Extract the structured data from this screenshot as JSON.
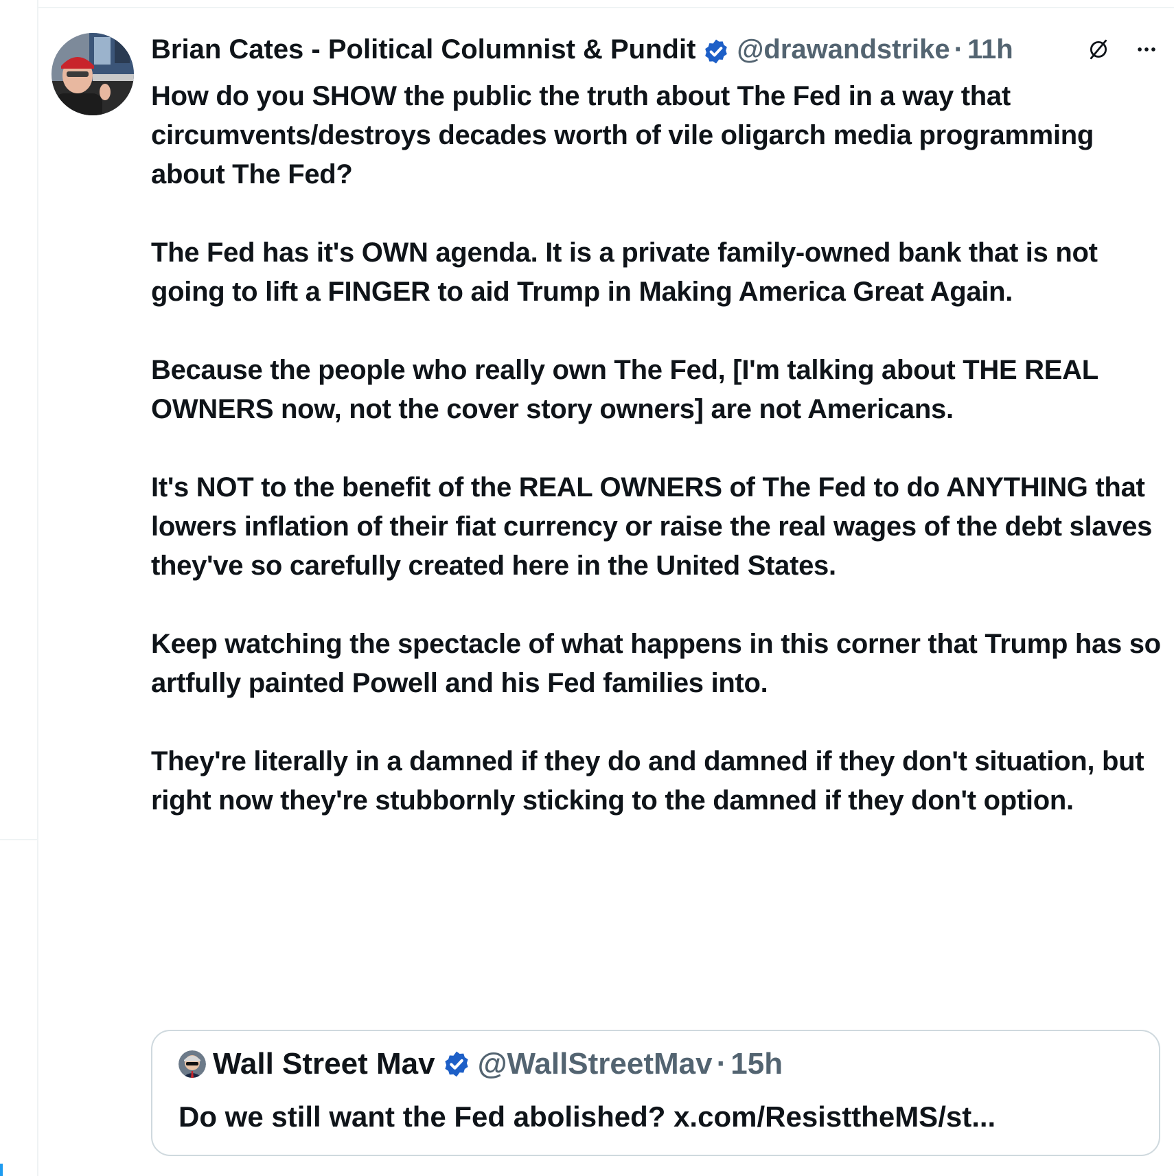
{
  "tweet": {
    "author": {
      "display_name": "Brian Cates - Political Columnist & Pundit",
      "handle": "@drawandstrike",
      "separator": "·",
      "time": "11h",
      "verified": true
    },
    "paragraphs": [
      "How do you SHOW the public the truth about The Fed in  a way that circumvents/destroys decades worth of vile oligarch media programming about The Fed?",
      "The Fed has it's OWN agenda. It is a private family-owned bank that is not going to lift a FINGER to aid Trump in Making America Great Again.",
      "Because the people who really own The Fed, [I'm talking about THE REAL OWNERS now, not the cover story owners] are not Americans.",
      "It's NOT to the benefit of the REAL OWNERS of The Fed to do ANYTHING that lowers inflation of their fiat currency or raise the real wages of the debt slaves they've so carefully created here  in the United States.",
      "Keep watching the spectacle of what happens in this corner that Trump has so artfully painted Powell and his Fed families into.",
      "They're literally in a damned if they do and damned if they don't situation, but right now they're stubbornly sticking to the damned if they don't option."
    ],
    "icons": {
      "grok": "grok-icon",
      "more": "more-icon",
      "verified": "verified-badge-icon"
    }
  },
  "quote": {
    "display_name": "Wall Street Mav",
    "handle": "@WallStreetMav",
    "separator": "·",
    "time": "15h",
    "verified": true,
    "text": "Do we still want the Fed abolished? x.com/ResisttheMS/st..."
  },
  "colors": {
    "text_primary": "#0f1419",
    "text_secondary": "#536471",
    "verified": "#1d5fc7",
    "border": "#cfd9de"
  }
}
